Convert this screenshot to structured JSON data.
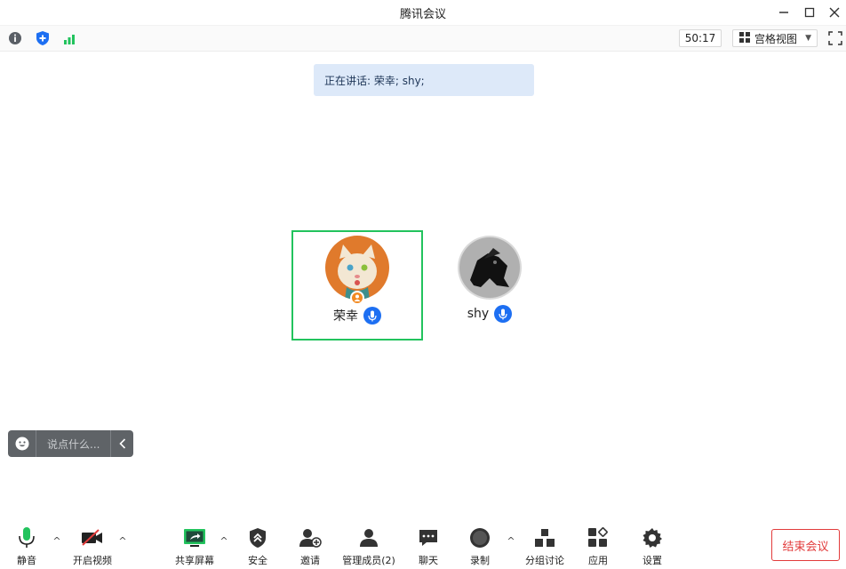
{
  "window": {
    "title": "腾讯会议",
    "minimize_icon": "minimize-icon",
    "maximize_icon": "maximize-icon",
    "close_icon": "close-icon"
  },
  "toolbar": {
    "info_icon": "info-icon",
    "security_icon": "shield-icon",
    "signal_icon": "signal-icon",
    "timer": "50:17",
    "view_label": "宫格视图",
    "fullscreen_icon": "fullscreen-icon"
  },
  "speaking": {
    "text": "正在讲话: 荣幸; shy;"
  },
  "participants": [
    {
      "name": "荣幸",
      "avatar": "cat-avatar",
      "active": true,
      "host": true,
      "mic": "mic-on"
    },
    {
      "name": "shy",
      "avatar": "dark-figure-avatar",
      "active": false,
      "host": false,
      "mic": "mic-on"
    }
  ],
  "chat": {
    "placeholder": "说点什么...",
    "emoji_icon": "emoji-icon",
    "collapse_icon": "chevron-left-icon"
  },
  "bottom": {
    "mute": "静音",
    "video": "开启视频",
    "share": "共享屏幕",
    "security": "安全",
    "invite": "邀请",
    "members": "管理成员(2)",
    "chat": "聊天",
    "record": "录制",
    "breakout": "分组讨论",
    "apps": "应用",
    "settings": "设置",
    "end": "结束会议"
  },
  "colors": {
    "active_border": "#22c35d",
    "mic_badge": "#1d6ff2",
    "end_button": "#e23b3b",
    "speaking_bg": "#dde9f9"
  }
}
